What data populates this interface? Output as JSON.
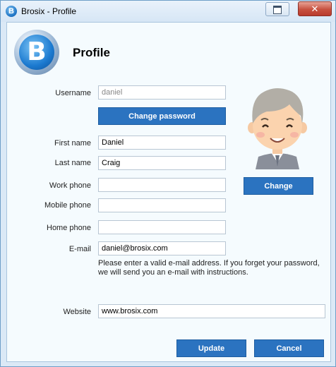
{
  "window": {
    "title": "Brosix - Profile",
    "close_symbol": "✕"
  },
  "logo": {
    "letter": "B"
  },
  "page": {
    "heading": "Profile"
  },
  "form": {
    "username": {
      "label": "Username",
      "value": "daniel"
    },
    "change_password_label": "Change password",
    "first_name": {
      "label": "First name",
      "value": "Daniel"
    },
    "last_name": {
      "label": "Last name",
      "value": "Craig"
    },
    "work_phone": {
      "label": "Work phone",
      "value": ""
    },
    "mobile_phone": {
      "label": "Mobile phone",
      "value": ""
    },
    "home_phone": {
      "label": "Home phone",
      "value": ""
    },
    "email": {
      "label": "E-mail",
      "value": "daniel@brosix.com"
    },
    "email_note": "Please enter a valid e-mail address. If you forget your password, we will send you an e-mail with instructions.",
    "website": {
      "label": "Website",
      "value": "www.brosix.com"
    }
  },
  "avatar": {
    "change_label": "Change"
  },
  "footer": {
    "update_label": "Update",
    "cancel_label": "Cancel"
  }
}
